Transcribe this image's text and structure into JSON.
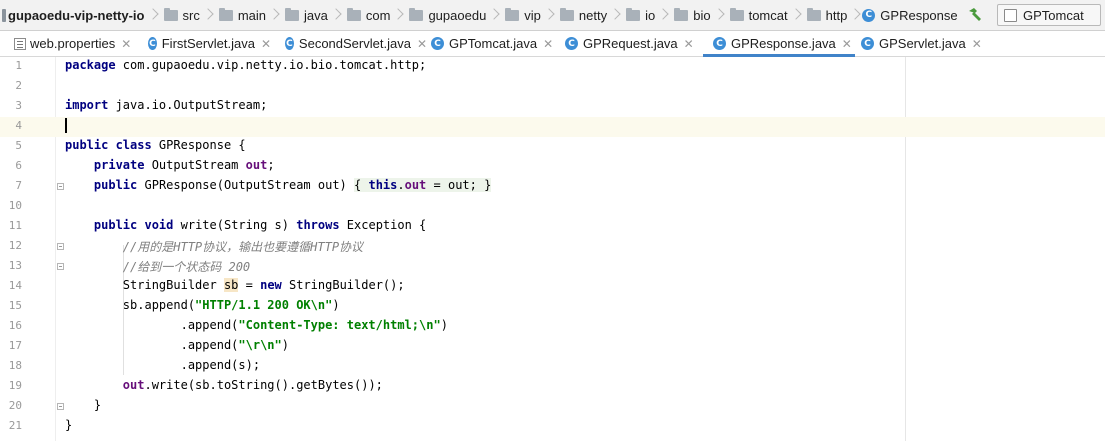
{
  "breadcrumb": {
    "project": "gupaoedu-vip-netty-io",
    "items": [
      "src",
      "main",
      "java",
      "com",
      "gupaoedu",
      "vip",
      "netty",
      "io",
      "bio",
      "tomcat",
      "http"
    ],
    "file": "GPResponse",
    "file_icon_letter": "C"
  },
  "toolbar": {
    "build_icon": "hammer-icon",
    "run_config": "GPTomcat"
  },
  "tabs": [
    {
      "label": "web.properties",
      "icon": "properties-file-icon"
    },
    {
      "label": "FirstServlet.java",
      "icon": "C"
    },
    {
      "label": "SecondServlet.java",
      "icon": "C"
    },
    {
      "label": "GPTomcat.java",
      "icon": "C"
    },
    {
      "label": "GPRequest.java",
      "icon": "C"
    },
    {
      "label": "GPResponse.java",
      "icon": "C",
      "active": true
    },
    {
      "label": "GPServlet.java",
      "icon": "C"
    }
  ],
  "editor": {
    "current_line": 4,
    "lines": [
      {
        "n": "1",
        "text": "package com.gupaoedu.vip.netty.io.bio.tomcat.http;"
      },
      {
        "n": "2",
        "text": ""
      },
      {
        "n": "3",
        "text": "import java.io.OutputStream;"
      },
      {
        "n": "4",
        "text": ""
      },
      {
        "n": "5",
        "text": "public class GPResponse {"
      },
      {
        "n": "6",
        "text": "    private OutputStream out;"
      },
      {
        "n": "7",
        "text": "    public GPResponse(OutputStream out) { this.out = out; }"
      },
      {
        "n": "10",
        "text": ""
      },
      {
        "n": "11",
        "text": "    public void write(String s) throws Exception {"
      },
      {
        "n": "12",
        "text": "        //用的是HTTP协议，输出也要遵循HTTP协议"
      },
      {
        "n": "13",
        "text": "        //给到一个状态码 200"
      },
      {
        "n": "14",
        "text": "        StringBuilder sb = new StringBuilder();"
      },
      {
        "n": "15",
        "text": "        sb.append(\"HTTP/1.1 200 OK\\n\")"
      },
      {
        "n": "16",
        "text": "                .append(\"Content-Type: text/html;\\n\")"
      },
      {
        "n": "17",
        "text": "                .append(\"\\r\\n\")"
      },
      {
        "n": "18",
        "text": "                .append(s);"
      },
      {
        "n": "19",
        "text": "        out.write(sb.toString().getBytes());"
      },
      {
        "n": "20",
        "text": "    }"
      },
      {
        "n": "21",
        "text": "}"
      }
    ]
  },
  "colors": {
    "keyword": "#000080",
    "field": "#660e7a",
    "string": "#008000",
    "comment": "#808080",
    "current_line_bg": "#fcfaed",
    "active_tab_underline": "#4083c9"
  }
}
